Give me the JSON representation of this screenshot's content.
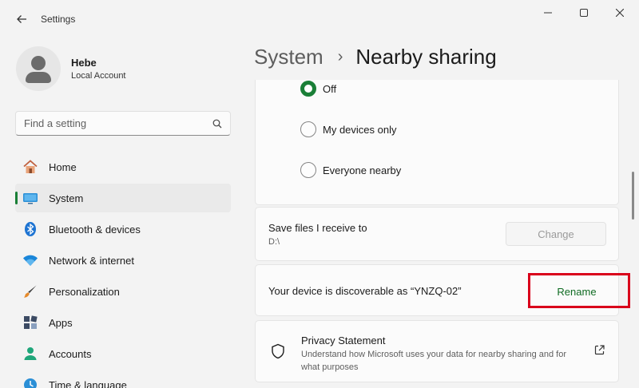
{
  "window": {
    "title": "Settings",
    "back_icon": "back-arrow-icon",
    "controls": [
      "minimize-icon",
      "maximize-icon",
      "close-icon"
    ]
  },
  "profile": {
    "name": "Hebe",
    "account_type": "Local Account"
  },
  "search": {
    "placeholder": "Find a setting",
    "icon": "search-icon"
  },
  "sidebar": {
    "items": [
      {
        "label": "Home",
        "icon": "home-icon"
      },
      {
        "label": "System",
        "icon": "system-icon",
        "active": true
      },
      {
        "label": "Bluetooth & devices",
        "icon": "bluetooth-icon"
      },
      {
        "label": "Network & internet",
        "icon": "wifi-icon"
      },
      {
        "label": "Personalization",
        "icon": "brush-icon"
      },
      {
        "label": "Apps",
        "icon": "apps-icon"
      },
      {
        "label": "Accounts",
        "icon": "accounts-icon"
      },
      {
        "label": "Time & language",
        "icon": "time-language-icon"
      }
    ]
  },
  "breadcrumb": {
    "parent": "System",
    "separator": "›",
    "current": "Nearby sharing"
  },
  "nearby_sharing": {
    "options": [
      {
        "label": "Off",
        "selected": true
      },
      {
        "label": "My devices only",
        "selected": false
      },
      {
        "label": "Everyone nearby",
        "selected": false
      }
    ]
  },
  "save_files": {
    "title": "Save files I receive to",
    "path": "D:\\",
    "button": "Change"
  },
  "device": {
    "text": "Your device is discoverable as “YNZQ-02”",
    "button": "Rename"
  },
  "privacy": {
    "title": "Privacy Statement",
    "description": "Understand how Microsoft uses your data for nearby sharing and for what purposes",
    "icon": "shield-icon",
    "link_icon": "open-external-icon"
  },
  "colors": {
    "accent": "#1a7f37",
    "highlight": "#d9001b",
    "background": "#f3f3f3",
    "card": "#fbfbfb"
  }
}
